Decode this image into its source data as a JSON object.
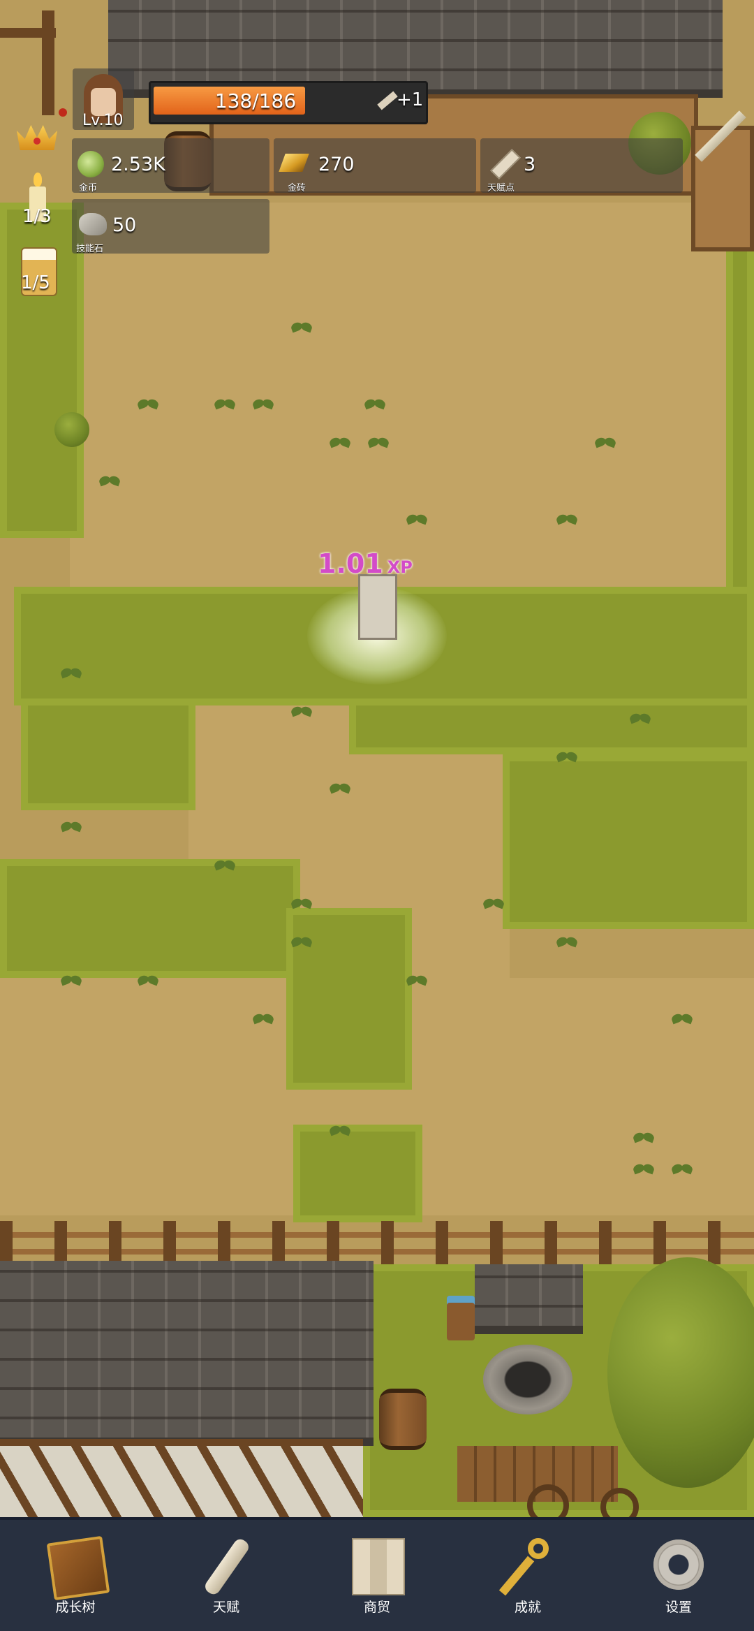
{
  "player": {
    "level": "Lv.10"
  },
  "xp": {
    "current": 138,
    "max": 186,
    "text": "138/186",
    "fill_fraction": 0.742,
    "bonus": "+1"
  },
  "resources": [
    {
      "icon": "cabbage-coin-icon",
      "value": "2.53K",
      "label": "金币"
    },
    {
      "icon": "gold-brick-icon",
      "value": "270",
      "label": "金砖"
    },
    {
      "icon": "talent-scroll-icon",
      "value": "3",
      "label": "天赋点"
    },
    {
      "icon": "skill-stone-icon",
      "value": "50",
      "label": "技能石"
    }
  ],
  "side": {
    "candle_count": "1/3",
    "beer_count": "1/5"
  },
  "float_text": {
    "value": "1.01",
    "unit": "XP"
  },
  "nav": [
    {
      "icon": "book-icon",
      "label": "成长树"
    },
    {
      "icon": "scroll-icon",
      "label": "天赋"
    },
    {
      "icon": "map-icon",
      "label": "商贸"
    },
    {
      "icon": "key-icon",
      "label": "成就"
    },
    {
      "icon": "gear-icon",
      "label": "设置"
    }
  ],
  "colors": {
    "xp_fill": "#e8732a",
    "float_text": "#d040c0",
    "nav_bg": "#283040"
  }
}
